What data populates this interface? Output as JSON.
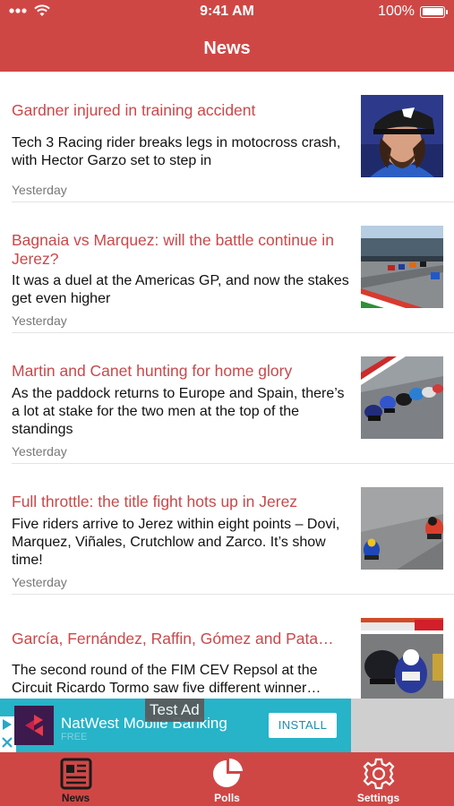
{
  "status_bar": {
    "time": "9:41 AM",
    "battery_text": "100%",
    "icons": [
      "signal-icon",
      "wifi-icon",
      "battery-icon"
    ]
  },
  "header": {
    "title": "News"
  },
  "articles": [
    {
      "title": "Gardner injured in training accident",
      "description": "Tech 3 Racing rider breaks legs in motocross crash, with Hector Garzo set to step in",
      "time": "Yesterday"
    },
    {
      "title": "Bagnaia vs Marquez: will the battle continue in Jerez?",
      "description": "It was a duel at the Americas GP, and now the stakes get even higher",
      "time": "Yesterday"
    },
    {
      "title": "Martin and Canet hunting for home glory",
      "description": "As the paddock returns to Europe and Spain, there’s a lot at stake for the two men at the top of the standings",
      "time": "Yesterday"
    },
    {
      "title": "Full throttle: the title fight hots up in Jerez",
      "description": "Five riders arrive to Jerez within eight points – Dovi, Marquez, Viñales, Crutchlow and Zarco. It’s show time!",
      "time": "Yesterday"
    },
    {
      "title": "García, Fernández, Raffin, Gómez and Pata…",
      "description": "The second round of the FIM CEV Repsol at the Circuit Ricardo Tormo saw five different winner…",
      "time": ""
    }
  ],
  "ad": {
    "label": "Test Ad",
    "app_name": "NatWest Mobile Banking",
    "sub_text": "FREE",
    "install_label": "INSTALL"
  },
  "tabs": [
    {
      "label": "News",
      "icon": "newspaper-icon",
      "active": true
    },
    {
      "label": "Polls",
      "icon": "pie-chart-icon",
      "active": false
    },
    {
      "label": "Settings",
      "icon": "gear-icon",
      "active": false
    }
  ],
  "colors": {
    "brand_red": "#cf4745",
    "headline_red": "#c9484a",
    "ad_teal": "#27b3c8"
  }
}
